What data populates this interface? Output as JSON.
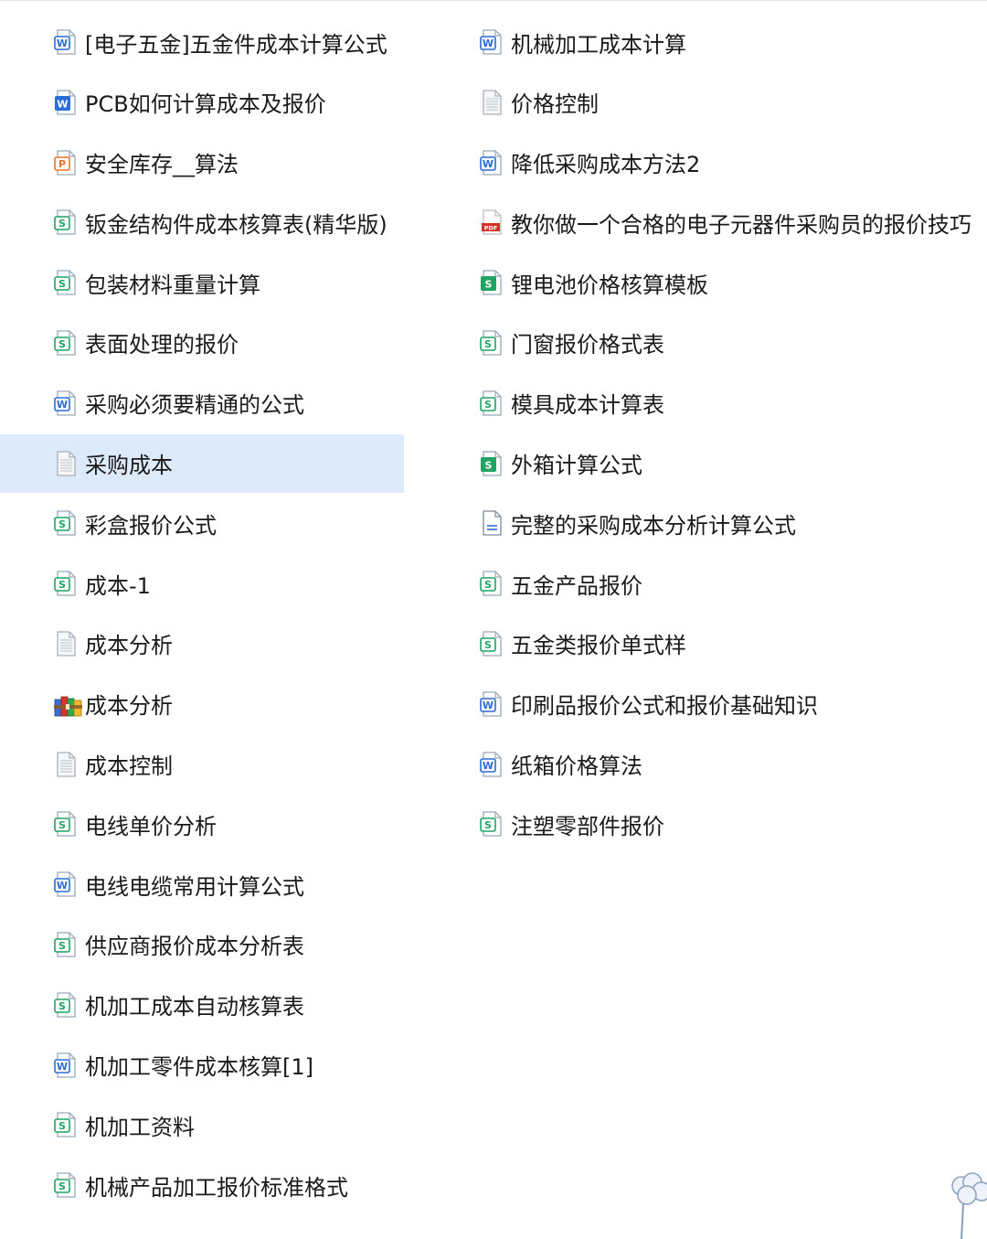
{
  "files": {
    "left": [
      {
        "name": "[电子五金]五金件成本计算公式",
        "type": "word",
        "icon": "word-doc-icon"
      },
      {
        "name": "PCB如何计算成本及报价",
        "type": "word-solid",
        "icon": "word-doc-solid-icon"
      },
      {
        "name": "安全库存__算法",
        "type": "ppt",
        "icon": "presentation-doc-icon"
      },
      {
        "name": "钣金结构件成本核算表(精华版)",
        "type": "sheet",
        "icon": "spreadsheet-doc-icon"
      },
      {
        "name": "包装材料重量计算",
        "type": "sheet",
        "icon": "spreadsheet-doc-icon"
      },
      {
        "name": "表面处理的报价",
        "type": "sheet",
        "icon": "spreadsheet-doc-icon"
      },
      {
        "name": "采购必须要精通的公式",
        "type": "word",
        "icon": "word-doc-icon"
      },
      {
        "name": "采购成本",
        "type": "txt",
        "icon": "text-doc-icon",
        "selected": true
      },
      {
        "name": "彩盒报价公式",
        "type": "sheet",
        "icon": "spreadsheet-doc-icon"
      },
      {
        "name": "成本-1",
        "type": "sheet",
        "icon": "spreadsheet-doc-icon"
      },
      {
        "name": "成本分析",
        "type": "txt",
        "icon": "text-doc-icon"
      },
      {
        "name": "成本分析",
        "type": "archive",
        "icon": "archive-books-icon"
      },
      {
        "name": "成本控制",
        "type": "txt",
        "icon": "text-doc-icon"
      },
      {
        "name": "电线单价分析",
        "type": "sheet",
        "icon": "spreadsheet-doc-icon"
      },
      {
        "name": "电线电缆常用计算公式",
        "type": "word",
        "icon": "word-doc-icon"
      },
      {
        "name": "供应商报价成本分析表",
        "type": "sheet",
        "icon": "spreadsheet-doc-icon"
      },
      {
        "name": "机加工成本自动核算表",
        "type": "sheet",
        "icon": "spreadsheet-doc-icon"
      },
      {
        "name": "机加工零件成本核算[1]",
        "type": "word",
        "icon": "word-doc-icon"
      },
      {
        "name": "机加工资料",
        "type": "sheet",
        "icon": "spreadsheet-doc-icon"
      },
      {
        "name": "机械产品加工报价标准格式",
        "type": "sheet",
        "icon": "spreadsheet-doc-icon"
      }
    ],
    "right": [
      {
        "name": "机械加工成本计算",
        "type": "word",
        "icon": "word-doc-icon"
      },
      {
        "name": "价格控制",
        "type": "txt",
        "icon": "text-doc-icon"
      },
      {
        "name": "降低采购成本方法2",
        "type": "word",
        "icon": "word-doc-icon"
      },
      {
        "name": "教你做一个合格的电子元器件采购员的报价技巧",
        "type": "pdf",
        "icon": "pdf-doc-icon"
      },
      {
        "name": "锂电池价格核算模板",
        "type": "sheet-solid",
        "icon": "spreadsheet-doc-solid-icon"
      },
      {
        "name": "门窗报价格式表",
        "type": "sheet",
        "icon": "spreadsheet-doc-icon"
      },
      {
        "name": "模具成本计算表",
        "type": "sheet",
        "icon": "spreadsheet-doc-icon"
      },
      {
        "name": "外箱计算公式",
        "type": "sheet-solid",
        "icon": "spreadsheet-doc-solid-icon"
      },
      {
        "name": "完整的采购成本分析计算公式",
        "type": "generic",
        "icon": "generic-doc-icon"
      },
      {
        "name": "五金产品报价",
        "type": "sheet",
        "icon": "spreadsheet-doc-icon"
      },
      {
        "name": "五金类报价单式样",
        "type": "sheet",
        "icon": "spreadsheet-doc-icon"
      },
      {
        "name": "印刷品报价公式和报价基础知识",
        "type": "word",
        "icon": "word-doc-icon"
      },
      {
        "name": "纸箱价格算法",
        "type": "word",
        "icon": "word-doc-icon"
      },
      {
        "name": "注塑零部件报价",
        "type": "sheet",
        "icon": "spreadsheet-doc-icon"
      }
    ]
  },
  "colors": {
    "selection_bg": "#ddeafa",
    "word_blue": "#2b6cd6",
    "sheet_green": "#1fa463",
    "ppt_orange": "#e8742b",
    "pdf_red": "#d93025"
  }
}
